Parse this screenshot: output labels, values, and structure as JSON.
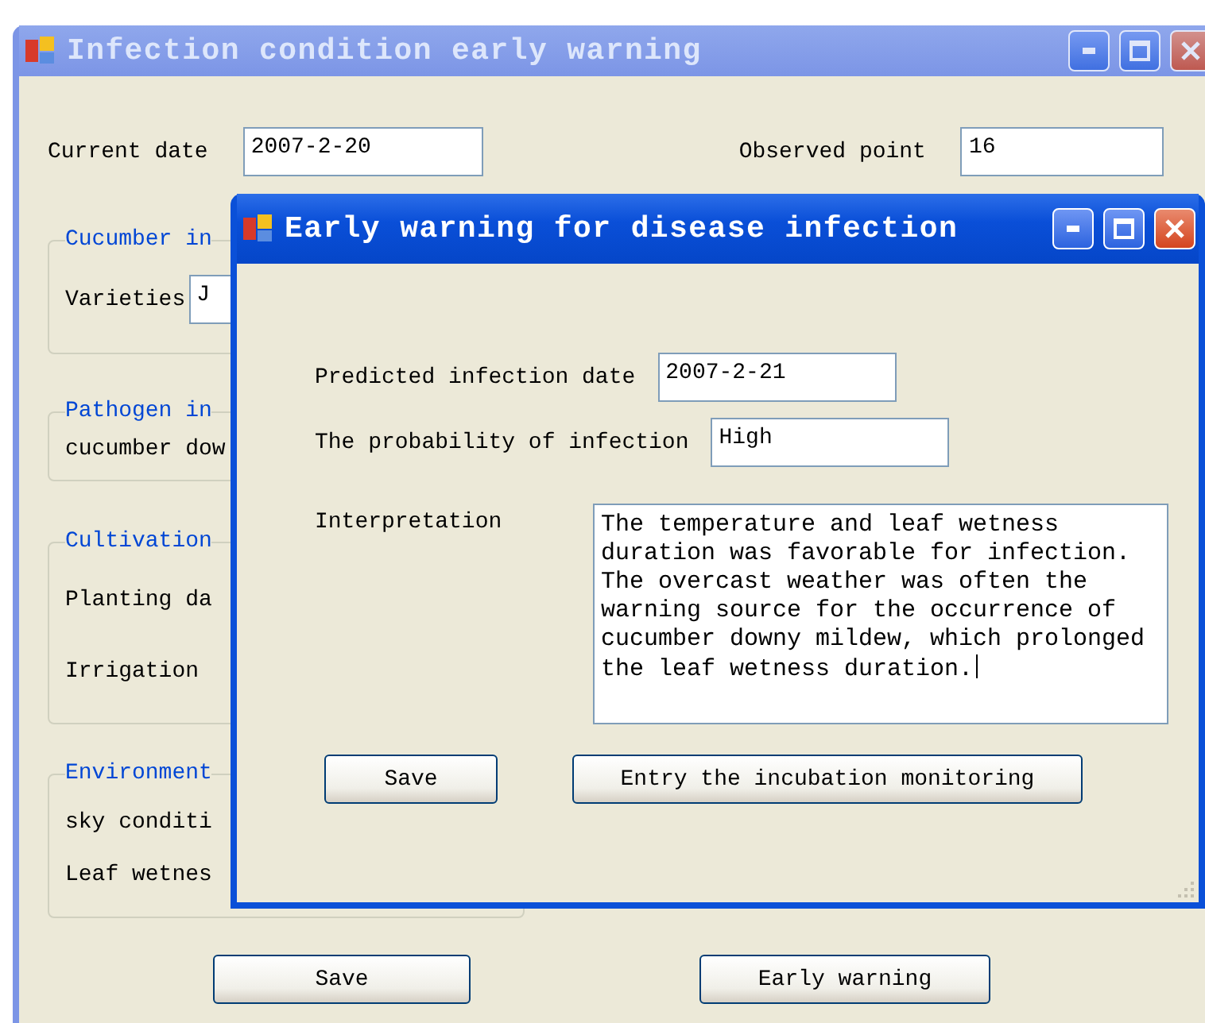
{
  "main_window": {
    "title": "Infection condition early warning",
    "fields": [
      {
        "label": "Current date",
        "value": "2007-2-20"
      },
      {
        "label": "Observed point",
        "value": "16"
      }
    ],
    "groups": [
      {
        "title": "Cucumber in",
        "rows": [
          {
            "label": "Varieties",
            "value": "J"
          }
        ]
      },
      {
        "title": "Pathogen in",
        "rows": [
          {
            "label": "cucumber dow"
          }
        ]
      },
      {
        "title": "Cultivation",
        "rows": [
          {
            "label": "Planting da"
          },
          {
            "label": "Irrigation"
          }
        ]
      },
      {
        "title": "Environment",
        "rows": [
          {
            "label": "sky conditi"
          },
          {
            "label": "Leaf wetnes"
          }
        ]
      }
    ],
    "buttons": [
      "Save",
      "Early warning"
    ]
  },
  "dialog": {
    "title": "Early warning for disease infection",
    "fields": [
      {
        "label": "Predicted infection date",
        "value": "2007-2-21"
      },
      {
        "label": "The probability of infection",
        "value": "High"
      }
    ],
    "interpretation": {
      "label": "Interpretation",
      "value": "The temperature and leaf wetness duration was favorable for infection. The overcast weather was often the warning source for the occurrence of cucumber downy mildew, which prolonged the leaf wetness duration.",
      "focused": true
    },
    "buttons": [
      "Save",
      "Entry the incubation monitoring"
    ]
  }
}
